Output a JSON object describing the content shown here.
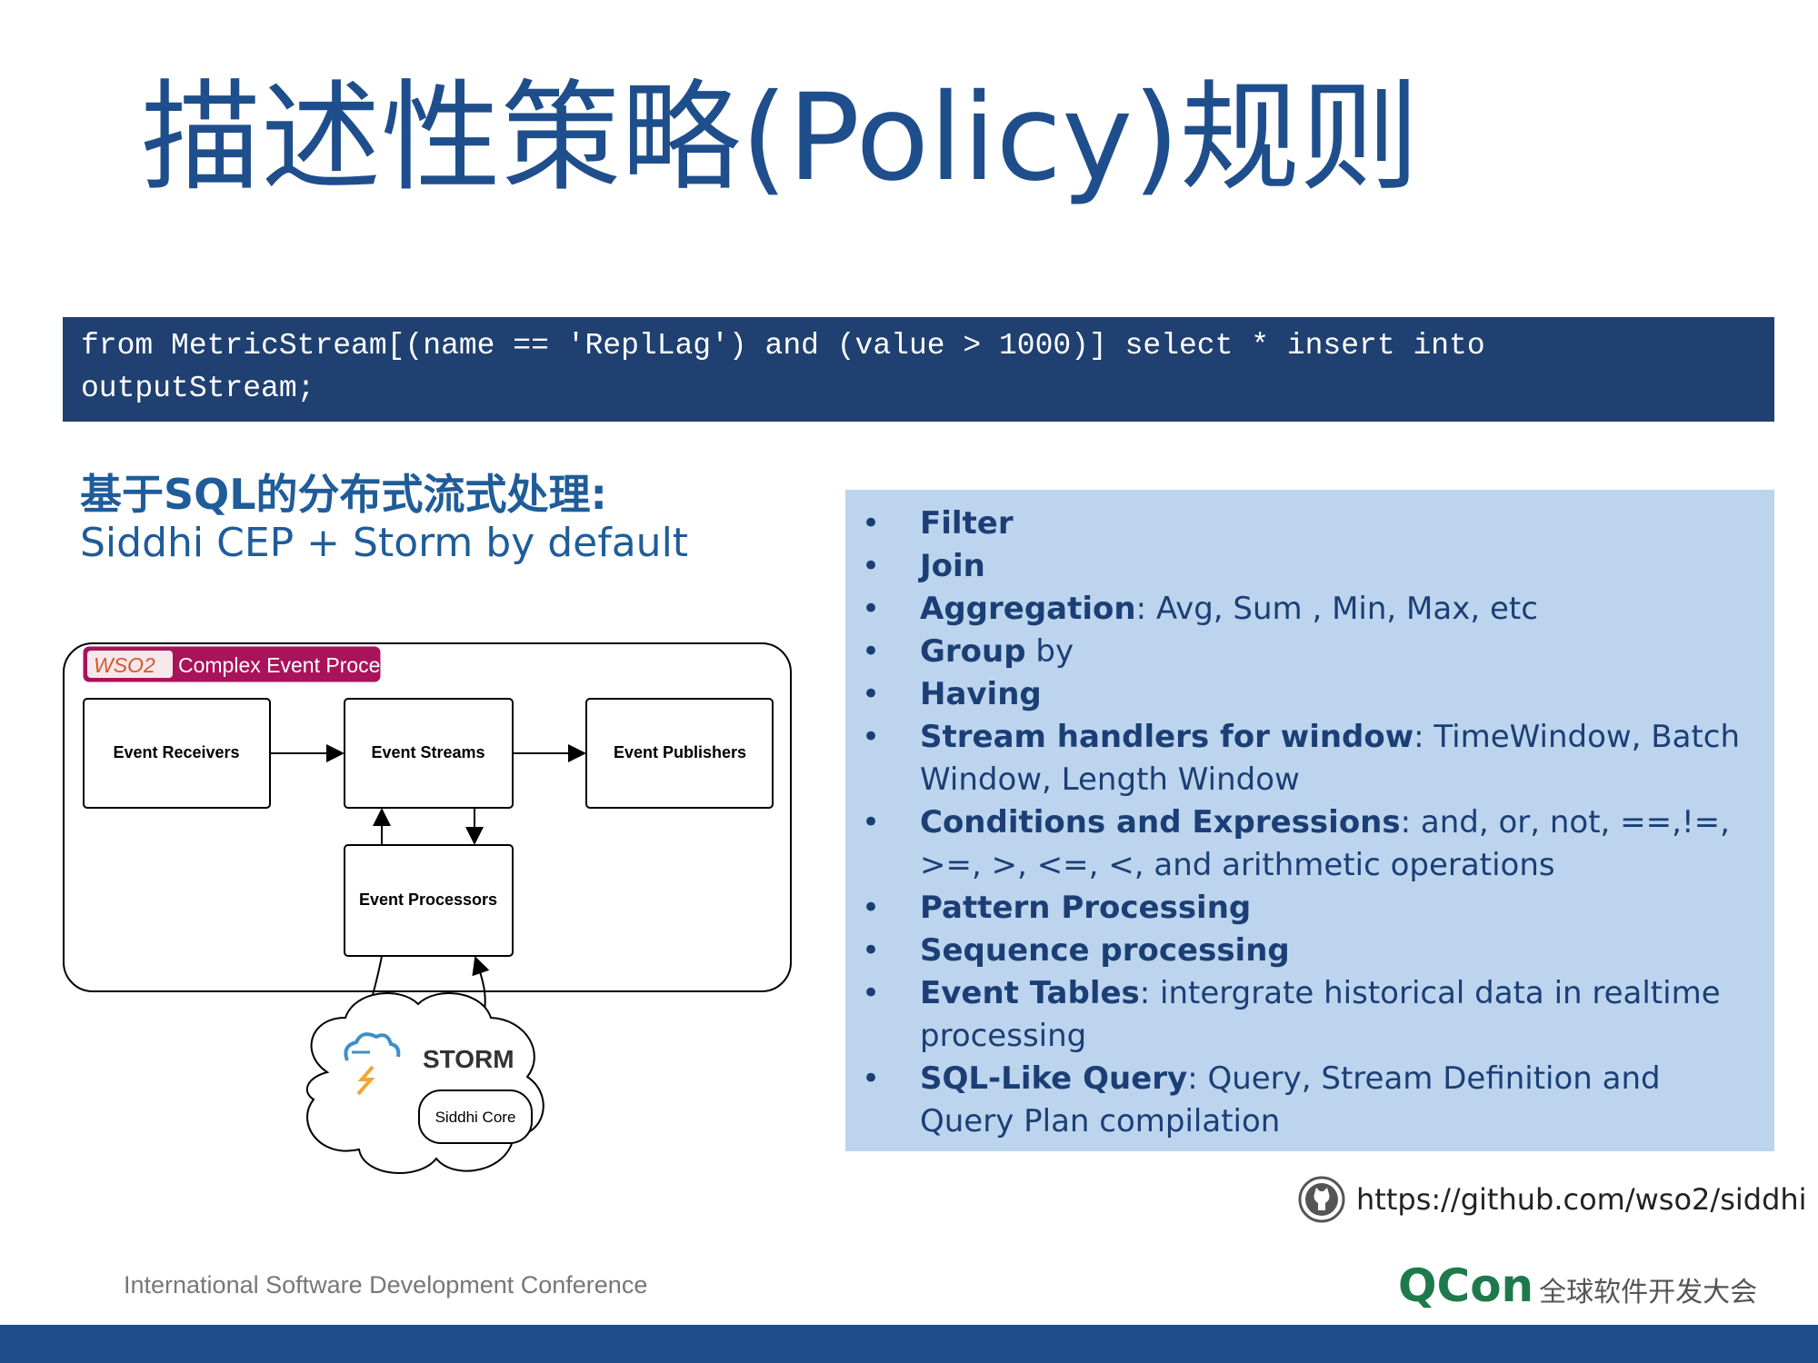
{
  "slide": {
    "title": "描述性策略(Policy)规则",
    "code_line1": "from MetricStream[(name == 'ReplLag') and (value > 1000)] select * insert into",
    "code_line2": "outputStream;",
    "subheading": "基于SQL的分布式流式处理:",
    "subtext": "Siddhi CEP + Storm by default"
  },
  "diagram": {
    "brand_logo": "WSO2",
    "header_label": "Complex Event Processor",
    "event_receivers": "Event Receivers",
    "event_streams": "Event Streams",
    "event_publishers": "Event Publishers",
    "event_processors": "Event Processors",
    "storm_label": "STORM",
    "siddhi_core": "Siddhi Core"
  },
  "features": [
    {
      "bold": "Filter",
      "rest": ""
    },
    {
      "bold": "Join",
      "rest": ""
    },
    {
      "bold": "Aggregation",
      "rest": ": Avg, Sum , Min, Max, etc"
    },
    {
      "bold": "Group",
      "rest": " by"
    },
    {
      "bold": "Having",
      "rest": ""
    },
    {
      "bold": "Stream handlers for window",
      "rest": ": TimeWindow, Batch Window, Length Window"
    },
    {
      "bold": "Conditions and Expressions",
      "rest": ": and, or, not, ==,!=, >=, >, <=, <, and arithmetic operations"
    },
    {
      "bold": "Pattern Processing",
      "rest": ""
    },
    {
      "bold": "Sequence processing",
      "rest": ""
    },
    {
      "bold": "Event Tables",
      "rest": ": intergrate historical data in realtime processing"
    },
    {
      "bold": "SQL-Like Query",
      "rest": ": Query, Stream Definition and Query Plan compilation"
    }
  ],
  "github_url": "https://github.com/wso2/siddhi",
  "footer": {
    "conference": "International Software Development Conference",
    "qcon": "QCon",
    "qcon_tagline": "全球软件开发大会"
  }
}
